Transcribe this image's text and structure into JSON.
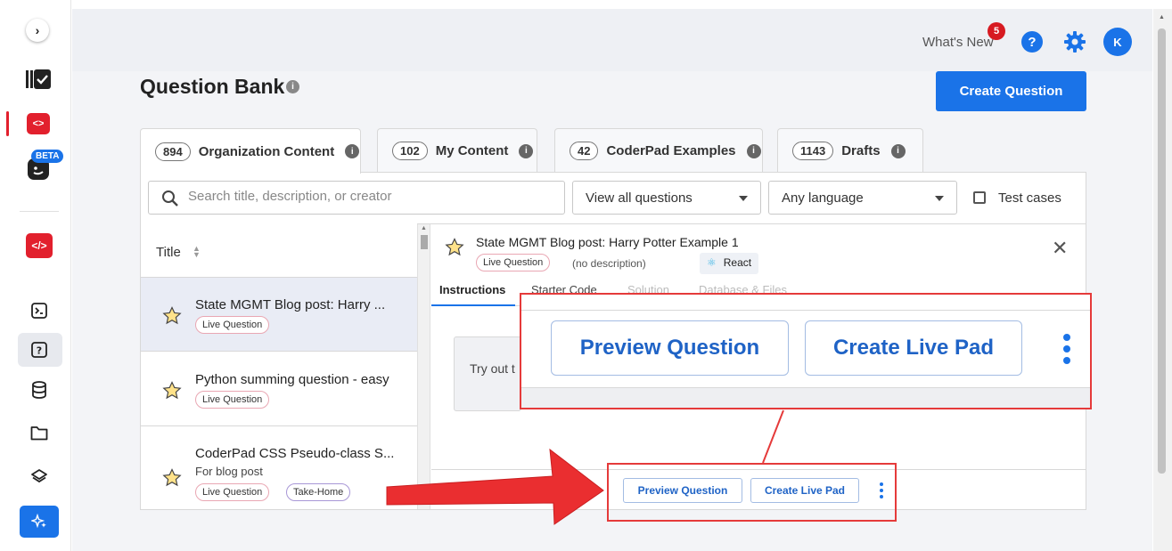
{
  "header": {
    "whats_new": "What's New",
    "notification_count": "5",
    "help_label": "?",
    "avatar_initial": "K"
  },
  "sidebar": {
    "beta_label": "BETA"
  },
  "page": {
    "title": "Question Bank",
    "info_symbol": "i",
    "create_button": "Create Question"
  },
  "tabs": [
    {
      "count": "894",
      "label": "Organization Content"
    },
    {
      "count": "102",
      "label": "My Content"
    },
    {
      "count": "42",
      "label": "CoderPad Examples"
    },
    {
      "count": "1143",
      "label": "Drafts"
    }
  ],
  "filters": {
    "search_placeholder": "Search title, description, or creator",
    "questions_select": "View all questions",
    "language_select": "Any language",
    "test_cases_label": "Test cases"
  },
  "list": {
    "header": "Title",
    "rows": [
      {
        "title": "State MGMT Blog post: Harry ...",
        "tags": [
          "Live Question"
        ]
      },
      {
        "title": "Python summing question - easy",
        "tags": [
          "Live Question"
        ]
      },
      {
        "title": "CoderPad CSS Pseudo-class S...",
        "description": "For blog post",
        "tags": [
          "Live Question",
          "Take-Home"
        ]
      }
    ]
  },
  "detail": {
    "title": "State MGMT Blog post: Harry Potter Example 1",
    "tag": "Live Question",
    "description": "(no description)",
    "language": "React",
    "tabs": [
      "Instructions",
      "Starter Code",
      "Solution",
      "Database & Files"
    ],
    "instructions_text": "Try out t",
    "preview_button": "Preview Question",
    "live_pad_button": "Create Live Pad"
  },
  "colors": {
    "accent": "#1a73e8",
    "brand_red": "#e2202d",
    "annotation_red": "#e53a3a"
  }
}
